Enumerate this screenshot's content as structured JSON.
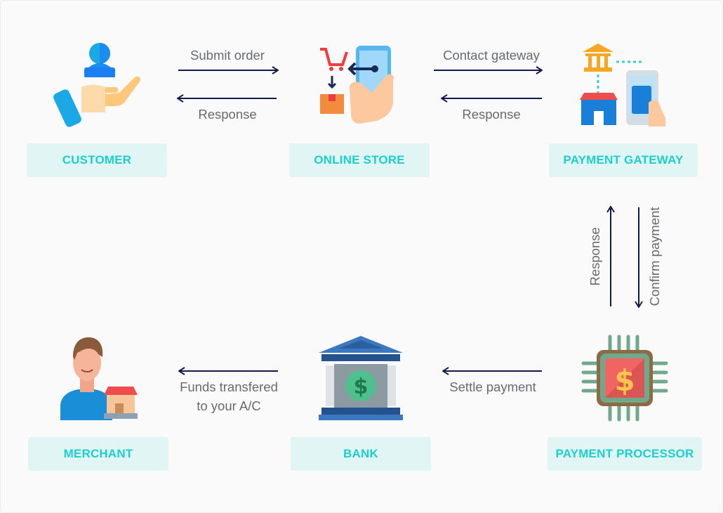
{
  "nodes": {
    "customer": "CUSTOMER",
    "online_store": "ONLINE STORE",
    "payment_gateway": "PAYMENT GATEWAY",
    "merchant": "MERCHANT",
    "bank": "BANK",
    "payment_processor": "PAYMENT PROCESSOR"
  },
  "edges": {
    "submit_order": "Submit order",
    "store_response": "Response",
    "contact_gateway": "Contact gateway",
    "gateway_response": "Response",
    "processor_response": "Response",
    "confirm_payment": "Confirm payment",
    "settle_payment": "Settle payment",
    "funds_line1": "Funds transfered",
    "funds_line2": "to your A/C"
  },
  "colors": {
    "label_bg": "#e1f5f4",
    "label_text": "#1ccfcf",
    "arrow": "#0f1a4a",
    "edge_text": "#666b70"
  }
}
